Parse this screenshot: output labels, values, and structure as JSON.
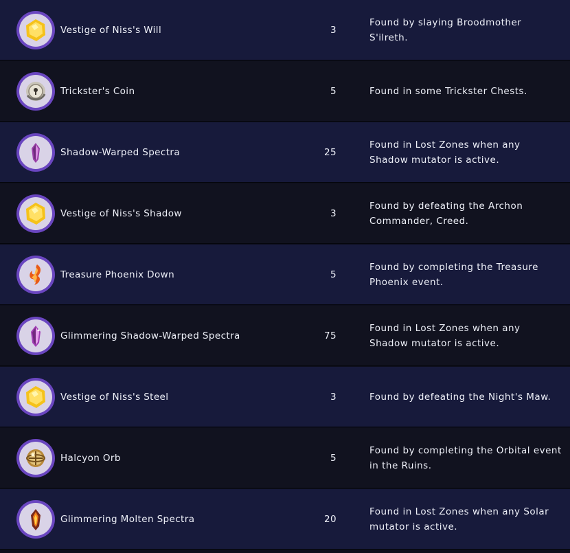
{
  "rows": [
    {
      "name": "Vestige of Niss's Will",
      "quantity": "3",
      "source": "Found by slaying Broodmother S'ilreth.",
      "icon": "gold-gem-icon"
    },
    {
      "name": "Trickster's Coin",
      "quantity": "5",
      "source": "Found in some Trickster Chests.",
      "icon": "silver-coin-icon"
    },
    {
      "name": "Shadow-Warped Spectra",
      "quantity": "25",
      "source": "Found in Lost Zones when any Shadow mutator is active.",
      "icon": "purple-crystal-icon"
    },
    {
      "name": "Vestige of Niss's Shadow",
      "quantity": "3",
      "source": "Found by defeating the Archon Commander, Creed.",
      "icon": "gold-gem-icon"
    },
    {
      "name": "Treasure Phoenix Down",
      "quantity": "5",
      "source": "Found by completing the Treasure Phoenix event.",
      "icon": "phoenix-feather-icon"
    },
    {
      "name": "Glimmering Shadow-Warped Spectra",
      "quantity": "75",
      "source": "Found in Lost Zones when any Shadow mutator is active.",
      "icon": "purple-crystal-icon"
    },
    {
      "name": "Vestige of Niss's Steel",
      "quantity": "3",
      "source": "Found by defeating the Night's Maw.",
      "icon": "gold-gem-icon"
    },
    {
      "name": "Halcyon Orb",
      "quantity": "5",
      "source": "Found by completing the Orbital event in the Ruins.",
      "icon": "golden-orb-icon"
    },
    {
      "name": "Glimmering Molten Spectra",
      "quantity": "20",
      "source": "Found in Lost Zones when any Solar mutator is active.",
      "icon": "molten-crystal-icon"
    }
  ],
  "colors": {
    "row_odd": "#171a3b",
    "row_even": "#11121f",
    "icon_ring": "#6a46c0",
    "text": "#eef0f8"
  }
}
